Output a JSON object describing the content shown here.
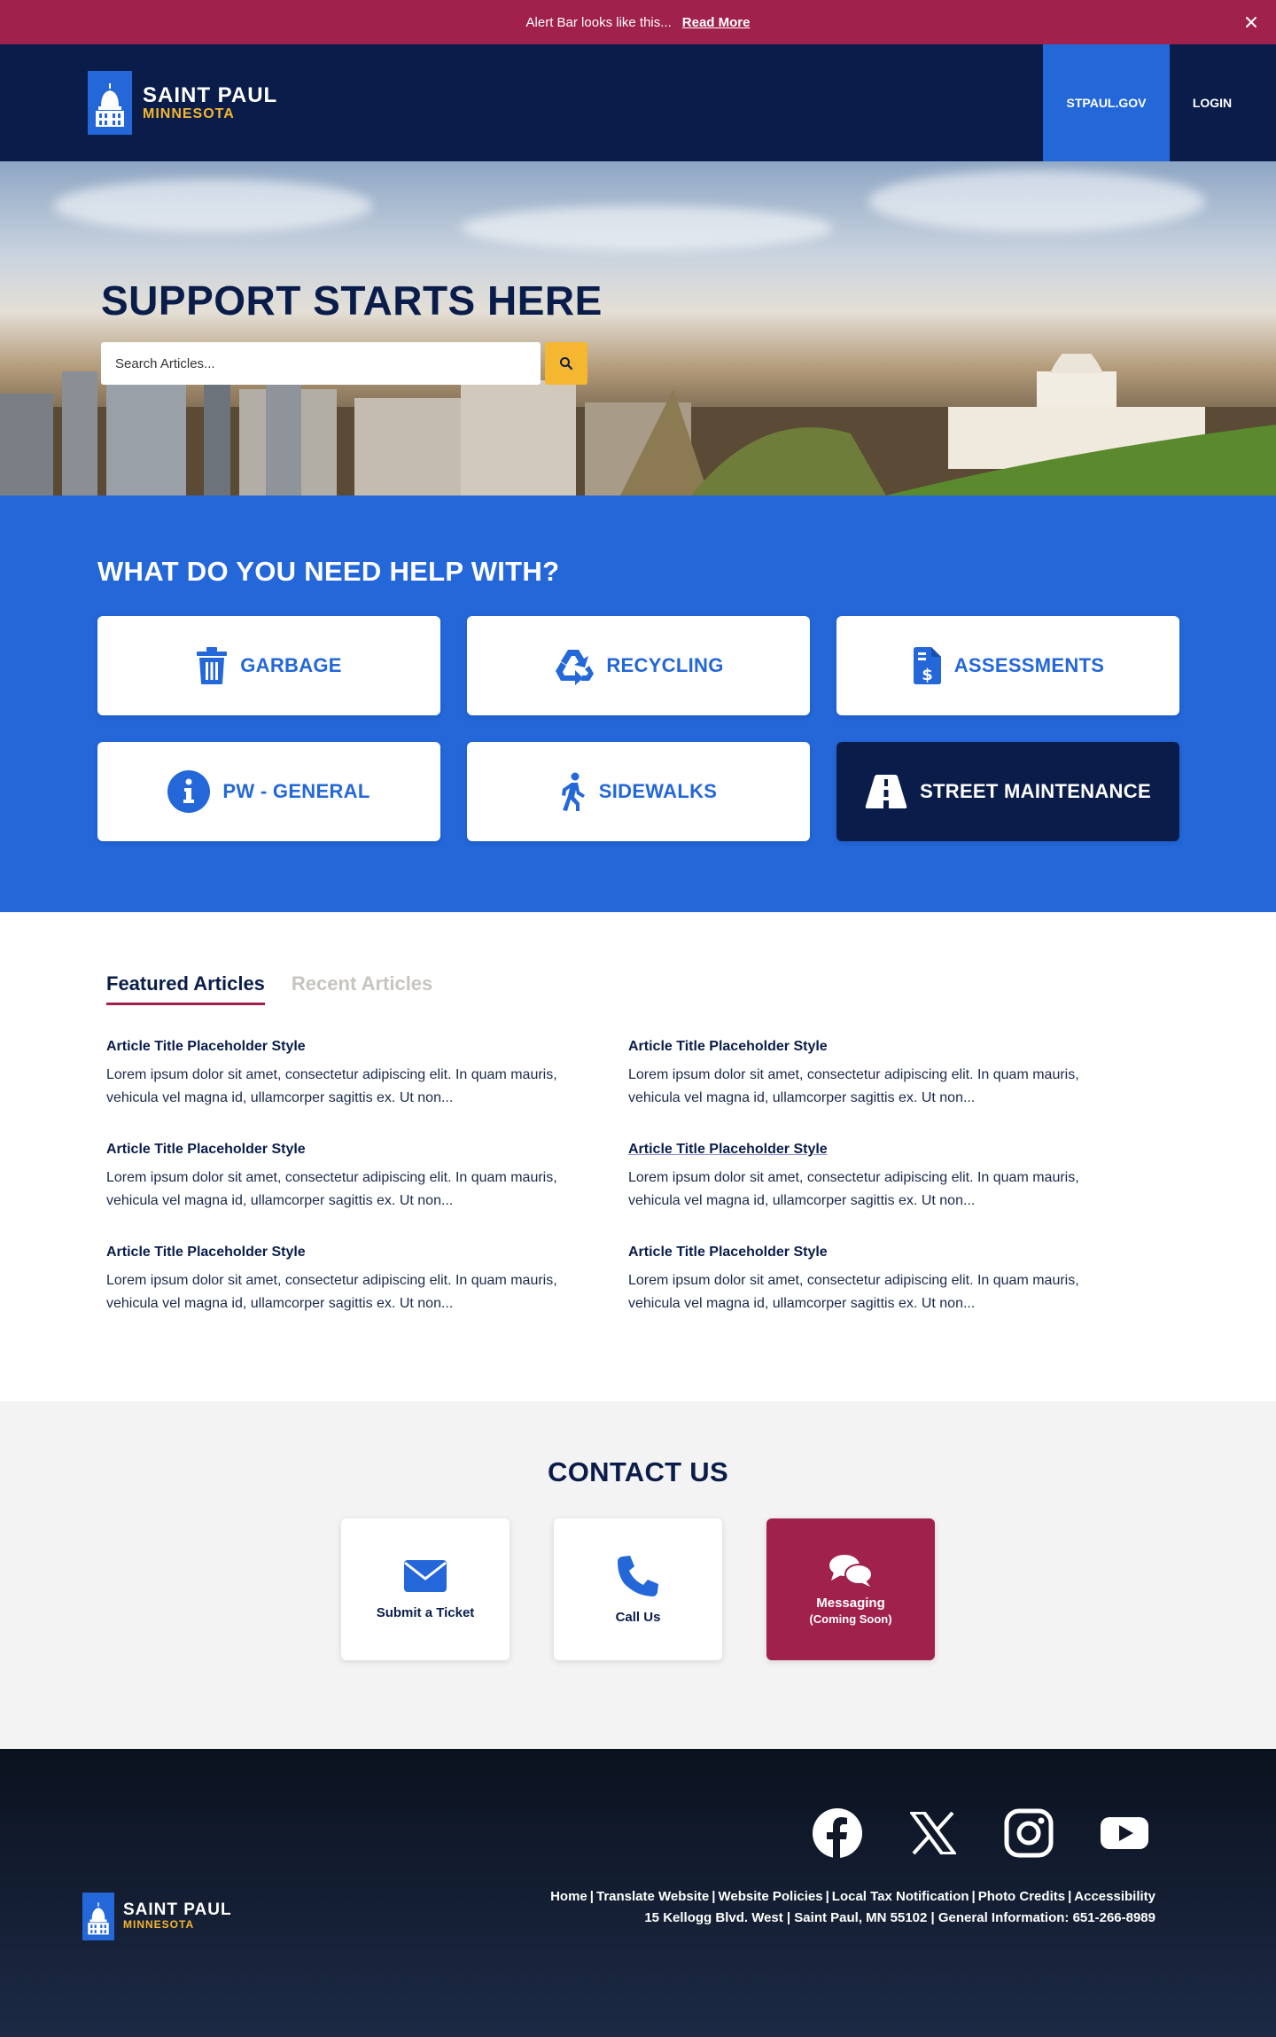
{
  "alert": {
    "text": "Alert Bar looks like this...",
    "link": "Read More"
  },
  "brand": {
    "line1": "SAINT PAUL",
    "line2": "MINNESOTA"
  },
  "nav": {
    "stpaul": "STPAUL.GOV",
    "login": "LOGIN"
  },
  "hero": {
    "title": "SUPPORT STARTS HERE",
    "search_placeholder": "Search Articles..."
  },
  "help": {
    "title": "WHAT DO YOU NEED HELP WITH?",
    "items": [
      {
        "label": "GARBAGE",
        "icon": "trash-icon"
      },
      {
        "label": "RECYCLING",
        "icon": "recycle-icon"
      },
      {
        "label": "ASSESSMENTS",
        "icon": "invoice-dollar-icon"
      },
      {
        "label": "PW - GENERAL",
        "icon": "info-icon"
      },
      {
        "label": "SIDEWALKS",
        "icon": "walking-person-icon"
      },
      {
        "label": "STREET MAINTENANCE",
        "icon": "road-icon"
      }
    ]
  },
  "articles": {
    "tabs": [
      "Featured Articles",
      "Recent Articles"
    ],
    "items": [
      {
        "title": "Article Title Placeholder Style",
        "body": "Lorem ipsum dolor sit amet, consectetur adipiscing elit. In quam mauris, vehicula vel magna id, ullamcorper sagittis ex. Ut non..."
      },
      {
        "title": "Article Title Placeholder Style",
        "body": "Lorem ipsum dolor sit amet, consectetur adipiscing elit. In quam mauris, vehicula vel magna id, ullamcorper sagittis ex. Ut non..."
      },
      {
        "title": "Article Title Placeholder Style",
        "body": "Lorem ipsum dolor sit amet, consectetur adipiscing elit. In quam mauris, vehicula vel magna id, ullamcorper sagittis ex. Ut non..."
      },
      {
        "title": "Article Title Placeholder Style",
        "body": "Lorem ipsum dolor sit amet, consectetur adipiscing elit. In quam mauris, vehicula vel magna id, ullamcorper sagittis ex. Ut non..."
      },
      {
        "title": "Article Title Placeholder Style",
        "body": "Lorem ipsum dolor sit amet, consectetur adipiscing elit. In quam mauris, vehicula vel magna id, ullamcorper sagittis ex. Ut non..."
      },
      {
        "title": "Article Title Placeholder Style",
        "body": "Lorem ipsum dolor sit amet, consectetur adipiscing elit. In quam mauris, vehicula vel magna id, ullamcorper sagittis ex. Ut non..."
      }
    ]
  },
  "contact": {
    "title": "CONTACT US",
    "ticket": "Submit a Ticket",
    "call": "Call Us",
    "messaging": "Messaging",
    "messaging_sub": "(Coming Soon)"
  },
  "footer": {
    "links": [
      "Home",
      "Translate Website",
      "Website Policies",
      "Local Tax Notification",
      "Photo Credits",
      "Accessibility"
    ],
    "address": "15 Kellogg Blvd. West | Saint Paul, MN 55102 | General Information: 651-266-8989",
    "socials": [
      "facebook-icon",
      "x-icon",
      "instagram-icon",
      "youtube-icon"
    ]
  },
  "colors": {
    "brand_navy": "#0a1d4a",
    "brand_blue": "#2367d9",
    "alert_red": "#a1214d",
    "accent_gold": "#f5b630"
  }
}
